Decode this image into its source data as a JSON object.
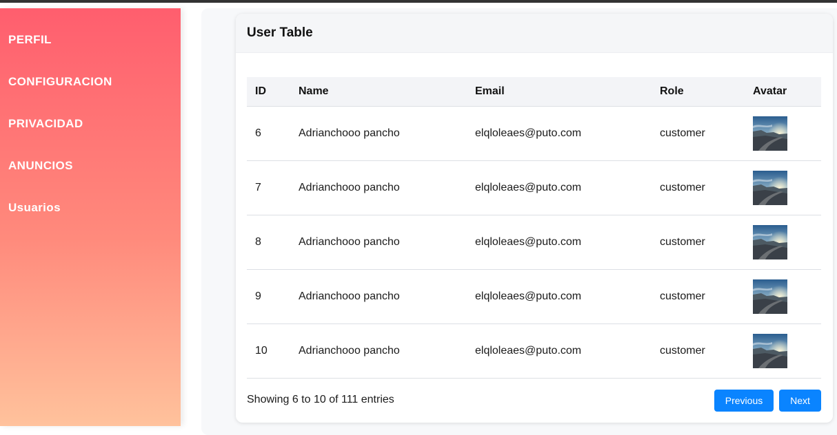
{
  "sidebar": {
    "items": [
      {
        "label": "PERFIL"
      },
      {
        "label": "CONFIGURACION"
      },
      {
        "label": "PRIVACIDAD"
      },
      {
        "label": "ANUNCIOS"
      },
      {
        "label": "Usuarios"
      }
    ]
  },
  "card": {
    "title": "User Table"
  },
  "table": {
    "headers": [
      "ID",
      "Name",
      "Email",
      "Role",
      "Avatar"
    ],
    "rows": [
      {
        "id": "6",
        "name": "Adrianchooo pancho",
        "email": "elqloleaes@puto.com",
        "role": "customer",
        "avatar": "avatar-image"
      },
      {
        "id": "7",
        "name": "Adrianchooo pancho",
        "email": "elqloleaes@puto.com",
        "role": "customer",
        "avatar": "avatar-image"
      },
      {
        "id": "8",
        "name": "Adrianchooo pancho",
        "email": "elqloleaes@puto.com",
        "role": "customer",
        "avatar": "avatar-image"
      },
      {
        "id": "9",
        "name": "Adrianchooo pancho",
        "email": "elqloleaes@puto.com",
        "role": "customer",
        "avatar": "avatar-image"
      },
      {
        "id": "10",
        "name": "Adrianchooo pancho",
        "email": "elqloleaes@puto.com",
        "role": "customer",
        "avatar": "avatar-image"
      }
    ]
  },
  "pagination": {
    "summary": "Showing 6 to 10 of 111 entries",
    "previous_label": "Previous",
    "next_label": "Next"
  },
  "colors": {
    "sidebar_top": "#ff5e6e",
    "sidebar_bottom": "#ffc29c",
    "button": "#0a84ff"
  }
}
